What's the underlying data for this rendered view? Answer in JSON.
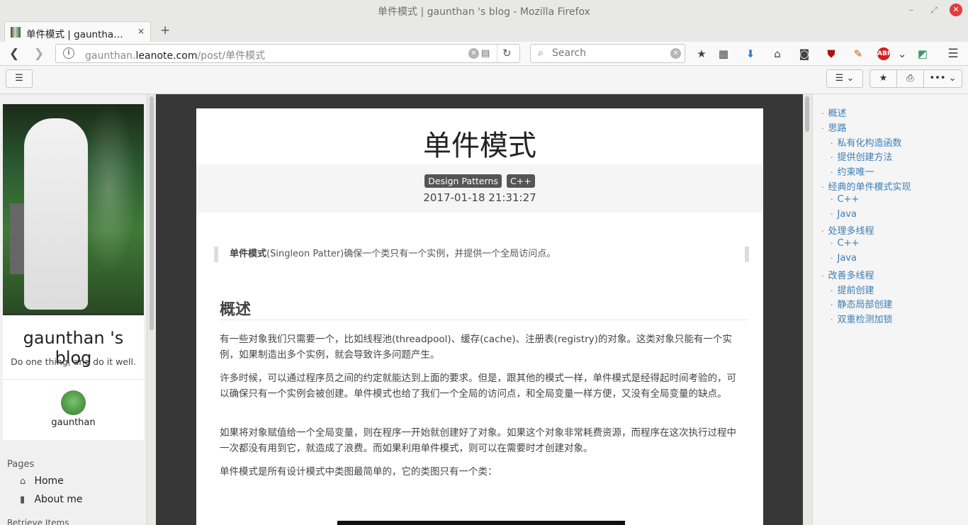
{
  "window": {
    "title": "单件模式 | gaunthan 's blog - Mozilla Firefox",
    "min_glyph": "–",
    "max_glyph": "⤢",
    "close_glyph": "✕"
  },
  "tab": {
    "label": "单件模式 | gauntha…",
    "close_glyph": "×",
    "new_tab_glyph": "+"
  },
  "nav": {
    "back_glyph": "❮",
    "forward_glyph": "❯",
    "url_prefix": "gaunthan.",
    "url_domain": "leanote.com",
    "url_path": "/post/单件模式",
    "info_glyph": "i",
    "clear_glyph": "✕",
    "reader_glyph": "▤",
    "reload_glyph": "↻",
    "search_placeholder": "Search",
    "search_glyph": "⌕",
    "menu_glyph": "☰"
  },
  "toolbar_icons": [
    {
      "name": "bookmark-star-icon",
      "glyph": "★",
      "color": "#444"
    },
    {
      "name": "reading-list-icon",
      "glyph": "▦",
      "color": "#444"
    },
    {
      "name": "downloads-icon",
      "glyph": "⬇",
      "color": "#2a7fd4"
    },
    {
      "name": "home-icon",
      "glyph": "⌂",
      "color": "#444"
    },
    {
      "name": "pocket-icon",
      "glyph": "◙",
      "color": "#444"
    },
    {
      "name": "ublock-icon",
      "glyph": "⛊",
      "color": "#b01010"
    },
    {
      "name": "extension-icon",
      "glyph": "✎",
      "color": "#c06010"
    },
    {
      "name": "adblock-plus-icon",
      "glyph": "ABP",
      "color": "#d02020"
    },
    {
      "name": "extensions-dropdown-icon",
      "glyph": "⌄",
      "color": "#444"
    },
    {
      "name": "translate-icon",
      "glyph": "◩",
      "color": "#3a9a6a"
    }
  ],
  "page_toolbar": {
    "sidebar_toggle_glyph": "☰",
    "list_glyph": "☰ ⌄",
    "star_glyph": "★",
    "print_glyph": "⎙",
    "more_glyph": "••• ⌄"
  },
  "sidebar": {
    "blog_title": "gaunthan 's blog",
    "blog_subtitle": "Do one thing, and do it well.",
    "author": "gaunthan",
    "pages_heading": "Pages",
    "pages": [
      {
        "label": "Home",
        "icon": "home-icon",
        "glyph": "⌂"
      },
      {
        "label": "About me",
        "icon": "bookmark-icon",
        "glyph": "▮"
      }
    ],
    "retrieve_heading": "Retrieve Items"
  },
  "article": {
    "title": "单件模式",
    "tags": [
      "Design Patterns",
      "C++"
    ],
    "date": "2017-01-18 21:31:27",
    "quote_bold": "单件模式",
    "quote_rest": "(Singleon Patter)确保一个类只有一个实例，并提供一个全局访问点。",
    "heading": "概述",
    "paragraphs": [
      "有一些对象我们只需要一个，比如线程池(threadpool)、缓存(cache)、注册表(registry)的对象。这类对象只能有一个实例，如果制造出多个实例，就会导致许多问题产生。",
      "许多时候，可以通过程序员之间的约定就能达到上面的要求。但是，跟其他的模式一样，单件模式是经得起时间考验的，可以确保只有一个实例会被创建。单件模式也给了我们一个全局的访问点，和全局变量一样方便，又没有全局变量的缺点。",
      "如果将对象赋值给一个全局变量，则在程序一开始就创建好了对象。如果这个对象非常耗费资源，而程序在这次执行过程中一次都没有用到它，就造成了浪费。而如果利用单件模式，则可以在需要时才创建对象。",
      "单件模式是所有设计模式中类图最简单的，它的类图只有一个类："
    ]
  },
  "toc": {
    "bullet": "·",
    "items": [
      {
        "label": "概述",
        "level": 1
      },
      {
        "label": "思路",
        "level": 1
      },
      {
        "label": "私有化构造函数",
        "level": 2
      },
      {
        "label": "提供创建方法",
        "level": 2
      },
      {
        "label": "约束唯一",
        "level": 2
      },
      {
        "label": "经典的单件模式实现",
        "level": 1
      },
      {
        "label": "C++",
        "level": 2
      },
      {
        "label": "Java",
        "level": 2
      },
      {
        "label": "处理多线程",
        "level": 1
      },
      {
        "label": "C++",
        "level": 2
      },
      {
        "label": "Java",
        "level": 2
      },
      {
        "label": "改善多线程",
        "level": 1
      },
      {
        "label": "提前创建",
        "level": 2
      },
      {
        "label": "静态局部创建",
        "level": 2
      },
      {
        "label": "双重检测加锁",
        "level": 2
      }
    ]
  },
  "colors": {
    "link": "#3c7fb8",
    "tag_bg": "#555555",
    "close_button": "#e23b3b",
    "main_bg": "#373737"
  }
}
